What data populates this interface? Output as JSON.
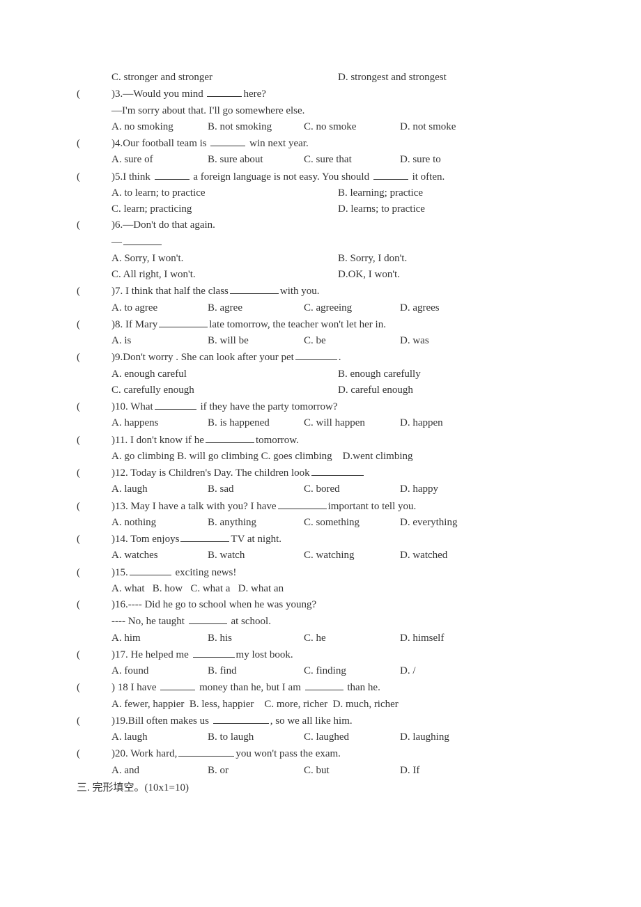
{
  "q2": {
    "C": "C. stronger and stronger",
    "D": "D. strongest and strongest"
  },
  "q3": {
    "stem_a": ")3.—Would you mind ",
    "stem_b": "here?",
    "line2": "—I'm sorry about that. I'll go somewhere else.",
    "A": "A. no smoking",
    "B": "B. not smoking",
    "C": "C. no smoke",
    "D": "D. not smoke"
  },
  "q4": {
    "stem_a": ")4.Our football team is ",
    "stem_b": " win next year.",
    "A": "A. sure of",
    "B": "B. sure about",
    "C": "C. sure that",
    "D": "D. sure to"
  },
  "q5": {
    "stem_a": ")5.I think ",
    "stem_b": " a foreign language is not easy. You should ",
    "stem_c": " it often.",
    "A": "A. to learn; to practice",
    "B": "B. learning; practice",
    "C": "C. learn; practicing",
    "D": "D. learns; to practice"
  },
  "q6": {
    "stem": ")6.—Don't do that again.",
    "line2": "—",
    "A": "A. Sorry, I won't.",
    "B": "B. Sorry, I don't.",
    "C": "C. All right, I won't.",
    "D": "D.OK, I won't."
  },
  "q7": {
    "stem_a": ")7. I think that half the class",
    "stem_b": "with you.",
    "A": "A. to agree",
    "B": "B. agree",
    "C": "C. agreeing",
    "D": "D. agrees"
  },
  "q8": {
    "stem_a": ")8. If Mary",
    "stem_b": "late tomorrow, the teacher won't let her in.",
    "A": "A. is",
    "B": "B. will be",
    "C": "C. be",
    "D": "D. was"
  },
  "q9": {
    "stem_a": ")9.Don't worry . She can look after your pet",
    "stem_b": ".",
    "A": "A. enough careful",
    "B": "B. enough carefully",
    "C": "C. carefully enough",
    "D": "D. careful enough"
  },
  "q10": {
    "stem_a": ")10. What",
    "stem_b": " if they have the party tomorrow?",
    "A": "A. happens",
    "B": "B. is happened",
    "C": "C. will happen",
    "D": "D. happen"
  },
  "q11": {
    "stem_a": ")11. I don't know if he",
    "stem_b": "tomorrow.",
    "A": "A. go climbing",
    "B": "B. will go climbing",
    "C": "C. goes climbing",
    "D": "D.went climbing"
  },
  "q12": {
    "stem_a": ")12. Today is Children's Day. The children look",
    "A": "A. laugh",
    "B": "B. sad",
    "C": "C. bored",
    "D": "D. happy"
  },
  "q13": {
    "stem_a": ")13. May I have a talk with you? I have",
    "stem_b": "important to tell you.",
    "A": "A. nothing",
    "B": "B. anything",
    "C": "C. something",
    "D": "D. everything"
  },
  "q14": {
    "stem_a": ")14. Tom enjoys",
    "stem_b": "TV at night.",
    "A": "A. watches",
    "B": "B. watch",
    "C": "C. watching",
    "D": "D. watched"
  },
  "q15": {
    "stem_a": ")15.",
    "stem_b": " exciting news!",
    "A": "A. what",
    "B": "B. how",
    "C": "C. what a",
    "D": "D. what an"
  },
  "q16": {
    "stem": ")16.---- Did he go to school when he was young?",
    "line2_a": "---- No, he taught ",
    "line2_b": " at school.",
    "A": "A. him",
    "B": "B. his",
    "C": "C. he",
    "D": "D. himself"
  },
  "q17": {
    "stem_a": ")17. He helped me ",
    "stem_b": "my lost book.",
    "A": "A. found",
    "B": "B. find",
    "C": "C. finding",
    "D": "D. /"
  },
  "q18": {
    "stem_a": ") 18 I have ",
    "stem_b": " money than he, but I am ",
    "stem_c": " than he.",
    "A": "A. fewer, happier",
    "B": "B. less, happier",
    "C": "C. more, richer",
    "D": "D. much, richer"
  },
  "q19": {
    "stem_a": ")19.Bill often makes us ",
    "stem_b": ", so we all like him.",
    "A": "A. laugh",
    "B": "B. to laugh",
    "C": "C. laughed",
    "D": "D. laughing"
  },
  "q20": {
    "stem_a": ")20. Work hard,",
    "stem_b": "you won't pass the exam.",
    "A": "A. and",
    "B": "B. or",
    "C": "C. but",
    "D": "D. If"
  },
  "section3": "三. 完形填空。(10x1=10)",
  "paren_open": "(",
  "paren_close": ""
}
